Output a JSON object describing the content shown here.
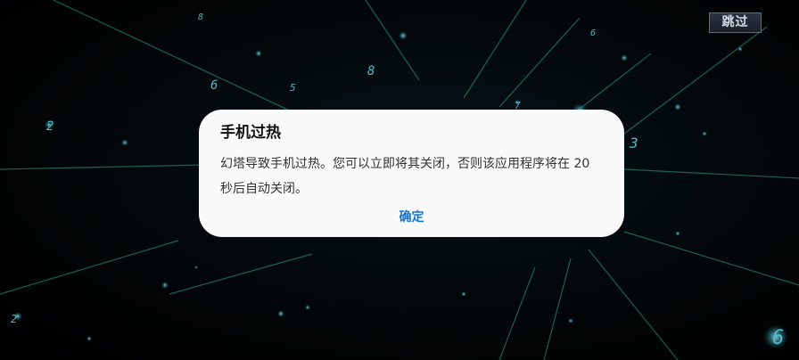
{
  "skip_button": {
    "label": "跳过"
  },
  "dialog": {
    "title": "手机过热",
    "message": "幻塔导致手机过热。您可以立即将其关闭，否则该应用程序将在 20 秒后自动关闭。",
    "confirm_label": "确定"
  },
  "background": {
    "digits": [
      "8",
      "6",
      "5",
      "2",
      "7",
      "3",
      "6",
      "2",
      "8",
      "6"
    ],
    "colors": {
      "glow": "#4fb8c9",
      "streak": "#2fa88c"
    }
  },
  "colors": {
    "dialog_bg": "#fafafa",
    "confirm_text": "#1a73c8"
  }
}
